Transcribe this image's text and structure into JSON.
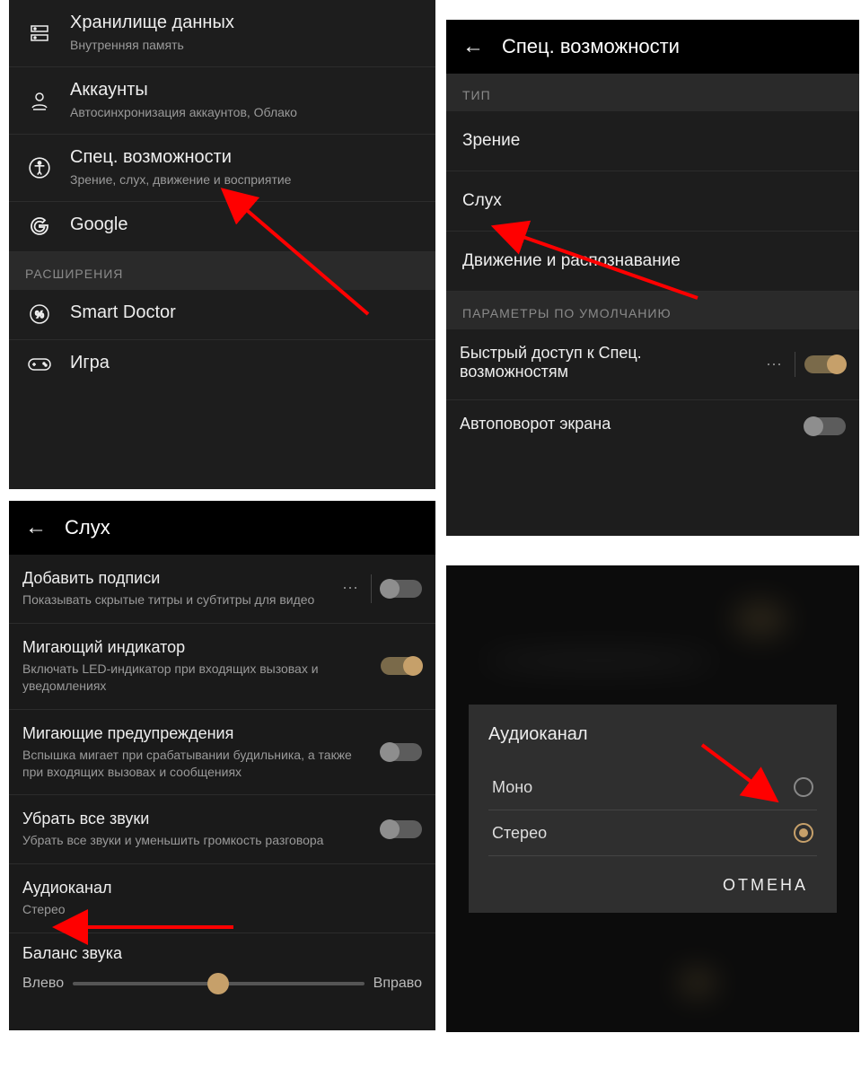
{
  "panel1": {
    "items": [
      {
        "title": "Хранилище данных",
        "sub": "Внутренняя память"
      },
      {
        "title": "Аккаунты",
        "sub": "Автосинхронизация аккаунтов, Облако"
      },
      {
        "title": "Спец. возможности",
        "sub": "Зрение, слух, движение и восприятие"
      },
      {
        "title": "Google",
        "sub": ""
      }
    ],
    "section_label": "РАСШИРЕНИЯ",
    "ext_items": [
      {
        "title": "Smart Doctor"
      },
      {
        "title": "Игра"
      }
    ]
  },
  "panel2": {
    "header": "Спец. возможности",
    "type_label": "ТИП",
    "types": [
      "Зрение",
      "Слух",
      "Движение и распознавание"
    ],
    "defaults_label": "ПАРАМЕТРЫ ПО УМОЛЧАНИЮ",
    "quick_access": "Быстрый доступ к Спец. возможностям",
    "auto_rotate": "Автоповорот экрана"
  },
  "panel3": {
    "header": "Слух",
    "rows": [
      {
        "title": "Добавить подписи",
        "sub": "Показывать скрытые титры и субтитры для видео",
        "on": false,
        "more": true
      },
      {
        "title": "Мигающий индикатор",
        "sub": "Включать LED-индикатор при входящих вызовах и уведомлениях",
        "on": true
      },
      {
        "title": "Мигающие предупреждения",
        "sub": "Вспышка мигает при срабатывании будильника, а также при входящих вызовах и сообщениях",
        "on": false
      },
      {
        "title": "Убрать все звуки",
        "sub": "Убрать все звуки и уменьшить громкость разговора",
        "on": false
      }
    ],
    "audio_channel": {
      "title": "Аудиоканал",
      "value": "Стерео"
    },
    "balance": {
      "title": "Баланс звука",
      "left": "Влево",
      "right": "Вправо"
    }
  },
  "panel4": {
    "dialog_title": "Аудиоканал",
    "options": [
      {
        "label": "Моно",
        "selected": false
      },
      {
        "label": "Стерео",
        "selected": true
      }
    ],
    "cancel": "ОТМЕНА"
  }
}
